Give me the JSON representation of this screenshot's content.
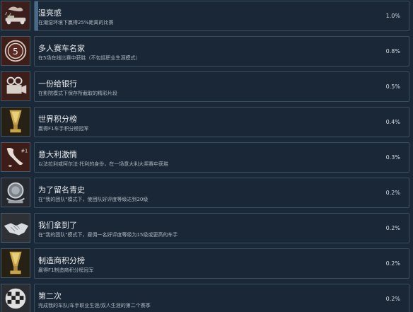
{
  "achievements": [
    {
      "title": "湿亮感",
      "description": "在潮湿环境下赢得25%距离的比赛",
      "percent_label": "1.0%",
      "percent_value": 1.0,
      "icon": "racing-car-wet-icon"
    },
    {
      "title": "多人赛车名家",
      "description": "在5场在线比赛中获胜（不包括职业生涯模式）",
      "percent_label": "0.8%",
      "percent_value": 0.8,
      "icon": "number-five-badge-icon"
    },
    {
      "title": "一份给银行",
      "description": "在影院模式下保存所截取的精彩片段",
      "percent_label": "0.5%",
      "percent_value": 0.5,
      "icon": "film-camera-icon"
    },
    {
      "title": "世界积分榜",
      "description": "赢得F1车手积分榜冠军",
      "percent_label": "0.4%",
      "percent_value": 0.4,
      "icon": "gold-trophy-icon"
    },
    {
      "title": "意大利激情",
      "description": "以法拉利或阿尔法·托利的身份，在一场意大利大奖赛中获胜",
      "percent_label": "0.3%",
      "percent_value": 0.3,
      "icon": "italy-map-icon"
    },
    {
      "title": "为了留名青史",
      "description": "在\"我的团队\"模式下，使团队好评度等级达到20级",
      "percent_label": "0.2%",
      "percent_value": 0.2,
      "icon": "laurel-emblem-icon"
    },
    {
      "title": "我们拿到了",
      "description": "在\"我的团队\"模式下，雇佣一名好评度等级为15级或更高的车手",
      "percent_label": "0.2%",
      "percent_value": 0.2,
      "icon": "handshake-icon"
    },
    {
      "title": "制造商积分榜",
      "description": "赢得F1制造商积分榜冠军",
      "percent_label": "0.2%",
      "percent_value": 0.2,
      "icon": "gold-trophy-icon"
    },
    {
      "title": "第二次",
      "description": "完成我的车队/车手职业生涯/双人生涯的第二个赛季",
      "percent_label": "0.2%",
      "percent_value": 0.2,
      "icon": "checkered-flag-icon"
    }
  ]
}
